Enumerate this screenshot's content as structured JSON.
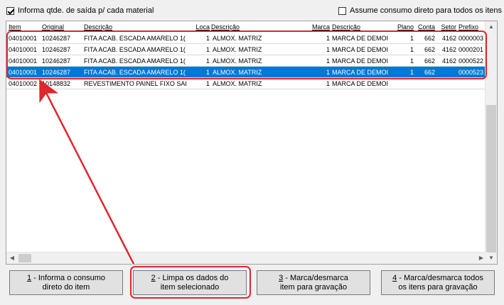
{
  "checkboxes": {
    "informa_label": "Informa qtde. de saída p/ cada material",
    "assume_label": "Assume consumo direto para todos os itens"
  },
  "columns": [
    "Item",
    "Original",
    "Descrição",
    "Loca",
    "Descrição",
    "Marca",
    "Descrição",
    "Plano",
    "Conta",
    "Setor",
    "Prefixo"
  ],
  "rows": [
    {
      "item": "04010001",
      "original": "10246287",
      "desc": "FITA ACAB. ESCADA AMARELO 1(",
      "loca": "1",
      "desc2": "ALMOX. MATRIZ",
      "marca": "1",
      "desc3": "MARCA DE DEMOI",
      "plano": "1",
      "conta": "662",
      "setor": "4162",
      "prefixo": "0000003"
    },
    {
      "item": "04010001",
      "original": "10246287",
      "desc": "FITA ACAB. ESCADA AMARELO 1(",
      "loca": "1",
      "desc2": "ALMOX. MATRIZ",
      "marca": "1",
      "desc3": "MARCA DE DEMOI",
      "plano": "1",
      "conta": "662",
      "setor": "4162",
      "prefixo": "0000201"
    },
    {
      "item": "04010001",
      "original": "10246287",
      "desc": "FITA ACAB. ESCADA AMARELO 1(",
      "loca": "1",
      "desc2": "ALMOX. MATRIZ",
      "marca": "1",
      "desc3": "MARCA DE DEMOI",
      "plano": "1",
      "conta": "662",
      "setor": "4162",
      "prefixo": "0000522"
    },
    {
      "item": "04010001",
      "original": "10246287",
      "desc": "FITA ACAB. ESCADA AMARELO 1(",
      "loca": "1",
      "desc2": "ALMOX. MATRIZ",
      "marca": "1",
      "desc3": "MARCA DE DEMOI",
      "plano": "1",
      "conta": "662",
      "setor": "",
      "prefixo": "0000523"
    },
    {
      "item": "04010002",
      "original": "10148832",
      "desc": "REVESTIMENTO PAINEL FIXO SAI",
      "loca": "1",
      "desc2": "ALMOX. MATRIZ",
      "marca": "1",
      "desc3": "MARCA DE DEMOI",
      "plano": "",
      "conta": "",
      "setor": "",
      "prefixo": ""
    }
  ],
  "buttons": {
    "b1_key": "1",
    "b1_rest": " - Informa o consumo",
    "b1_line2": "direto do item",
    "b2_key": "2",
    "b2_rest": " - Limpa os dados do",
    "b2_line2": "item selecionado",
    "b3_key": "3",
    "b3_rest": " - Marca/desmarca",
    "b3_line2": "item para gravação",
    "b4_key": "4",
    "b4_rest": " - Marca/desmarca todos",
    "b4_line2": "os itens para gravação"
  },
  "colors": {
    "selection": "#0078d7",
    "highlight": "#e0262d"
  }
}
